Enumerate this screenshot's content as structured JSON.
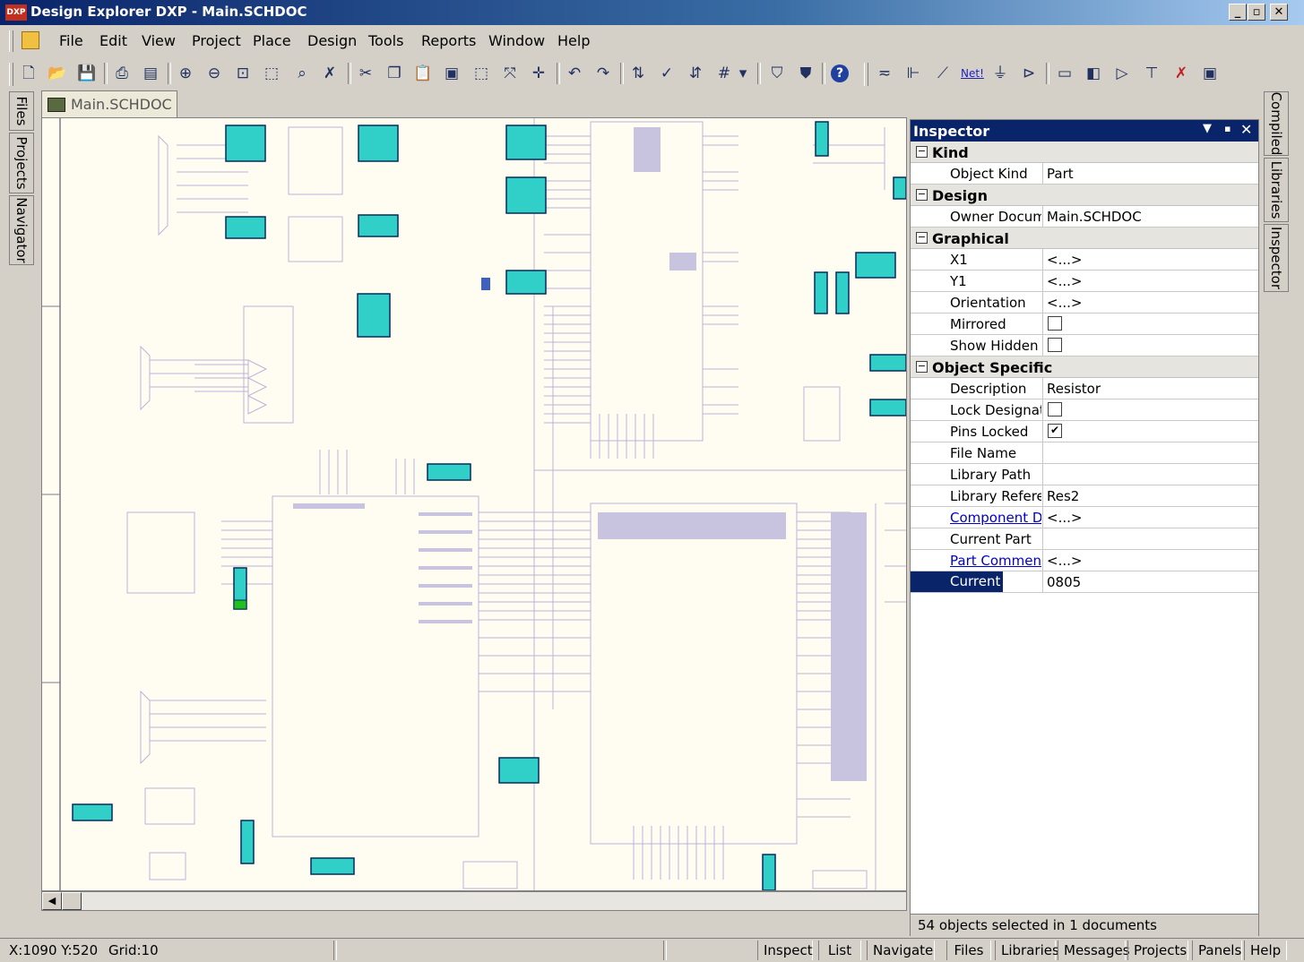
{
  "window": {
    "logo_text": "DXP",
    "title": "Design Explorer DXP - Main.SCHDOC",
    "minimize": "_",
    "restore": "▫",
    "close": "✕"
  },
  "menu": [
    "File",
    "Edit",
    "View",
    "Project",
    "Place",
    "Design",
    "Tools",
    "Reports",
    "Window",
    "Help"
  ],
  "toolbar_icons": [
    "new-document-icon",
    "open-folder-icon",
    "save-icon",
    "print-icon",
    "print-preview-icon",
    "zoom-in-icon",
    "zoom-out-icon",
    "zoom-fit-icon",
    "zoom-area-icon",
    "zoom-selected-icon",
    "clear-filter-icon",
    "cut-icon",
    "copy-icon",
    "paste-icon",
    "rubber-stamp-icon",
    "select-area-icon",
    "deselect-icon",
    "move-icon",
    "undo-icon",
    "redo-icon",
    "hierarchy-icon",
    "cross-probe-icon",
    "browse-component-icon",
    "grid-icon",
    "dropdown-icon",
    "compile-icon",
    "mask-icon",
    "help-icon",
    "wire-icon",
    "bus-icon",
    "bus-entry-icon",
    "net-label-icon",
    "power-port-icon",
    "port-icon",
    "sheet-symbol-icon",
    "sheet-entry-icon",
    "device-sheet-icon",
    "junction-icon",
    "no-erc-icon",
    "pcb-layout-icon"
  ],
  "net_label_text": "Net!",
  "left_tabs": [
    "Files",
    "Projects",
    "Navigator"
  ],
  "right_tabs": [
    "Compiled",
    "Libraries",
    "Inspector"
  ],
  "doc_tab": "Main.SCHDOC",
  "inspector": {
    "title": "Inspector",
    "groups": [
      {
        "name": "Kind",
        "rows": [
          {
            "label": "Object Kind",
            "value": "Part"
          }
        ]
      },
      {
        "name": "Design",
        "rows": [
          {
            "label": "Owner Document",
            "value": "Main.SCHDOC"
          }
        ]
      },
      {
        "name": "Graphical",
        "rows": [
          {
            "label": "X1",
            "value": "<...>"
          },
          {
            "label": "Y1",
            "value": "<...>"
          },
          {
            "label": "Orientation",
            "value": "<...>"
          },
          {
            "label": "Mirrored",
            "value": "",
            "check": false
          },
          {
            "label": "Show Hidden Pins",
            "value": "",
            "check": false
          }
        ]
      },
      {
        "name": "Object Specific",
        "rows": [
          {
            "label": "Description",
            "value": "Resistor"
          },
          {
            "label": "Lock Designator",
            "value": "",
            "check": false
          },
          {
            "label": "Pins Locked",
            "value": "",
            "check": true
          },
          {
            "label": "File Name",
            "value": ""
          },
          {
            "label": "Library Path",
            "value": ""
          },
          {
            "label": "Library Reference",
            "value": "Res2"
          },
          {
            "label": "Component Designator",
            "value": "<...>",
            "link": true
          },
          {
            "label": "Current Part",
            "value": ""
          },
          {
            "label": "Part Comment",
            "value": "<...>",
            "link": true
          },
          {
            "label": "Current Footprint",
            "value": "0805",
            "selected": true
          }
        ]
      }
    ],
    "status": "54 objects selected in 1 documents"
  },
  "status": {
    "coords": "X:1090 Y:520",
    "grid": "Grid:10",
    "buttons": [
      "Inspect",
      "List",
      "Navigate",
      "Files",
      "Libraries",
      "Messages",
      "Projects",
      "Panels",
      "Help"
    ]
  }
}
